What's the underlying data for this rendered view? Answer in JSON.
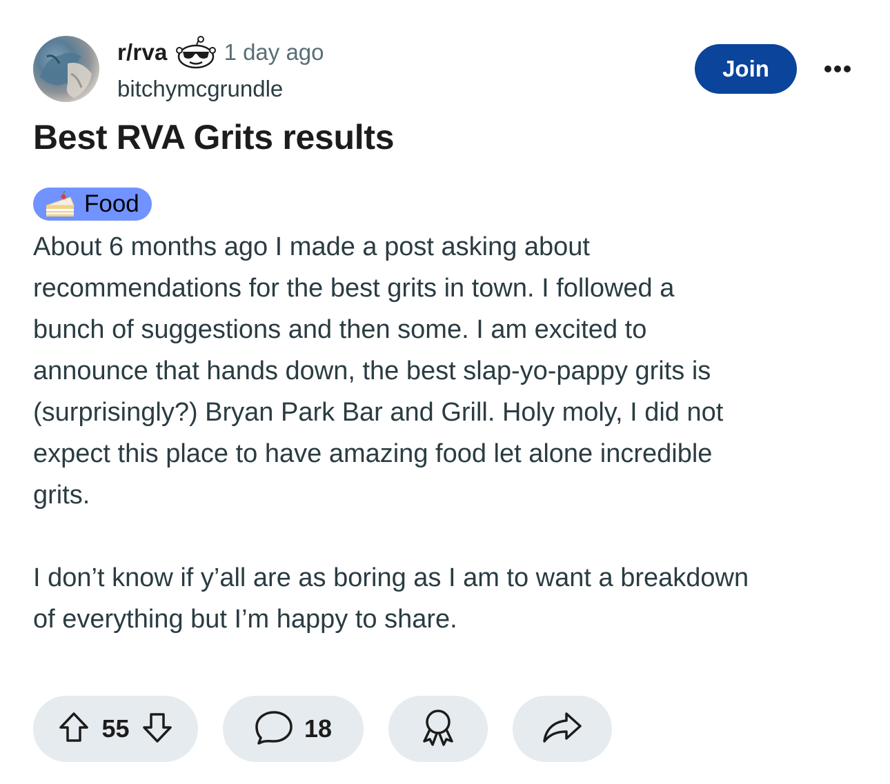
{
  "post": {
    "subreddit": "r/rva",
    "time": "1 day ago",
    "author": "bitchymcgrundle",
    "join_label": "Join",
    "title": "Best RVA Grits results",
    "flair": {
      "label": "Food",
      "emoji": "shortcake-icon",
      "color": "#7193ff"
    },
    "body": [
      "About 6 months ago I made a post asking about\nrecommendations for the best grits in town. I followed a\nbunch of suggestions and then some. I am excited to\nannounce that hands down, the best slap-yo-pappy grits is\n(surprisingly?) Bryan Park Bar and Grill. Holy moly, I did not\nexpect this place to have amazing food let alone incredible\ngrits.",
      "I don’t know if y’all are as boring as I am to want a breakdown\nof everything but I’m happy to share."
    ]
  },
  "actions": {
    "score": "55",
    "comments": "18"
  },
  "colors": {
    "join_button": "#0a449b",
    "pill_background": "#e5ebee",
    "secondary_text": "#576f76"
  }
}
